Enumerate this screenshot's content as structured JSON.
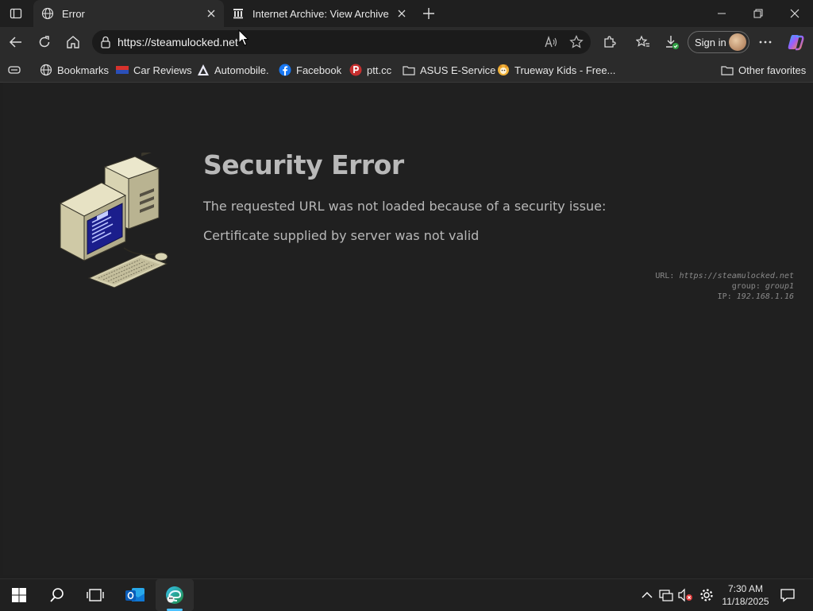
{
  "tabs": [
    {
      "title": "Error",
      "active": true
    },
    {
      "title": "Internet Archive: View Archive",
      "active": false
    }
  ],
  "address": {
    "url": "https://steamulocked.net"
  },
  "profile": {
    "signin_label": "Sign in"
  },
  "bookmarks": [
    {
      "label": "Bookmarks",
      "icon": "globe-icon"
    },
    {
      "label": "Car Reviews",
      "icon": "flag-icon"
    },
    {
      "label": "Automobile.",
      "icon": "triangle-logo-icon"
    },
    {
      "label": "Facebook",
      "icon": "facebook-icon"
    },
    {
      "label": "ptt.cc",
      "icon": "p-logo-icon"
    },
    {
      "label": "ASUS E-Service",
      "icon": "folder-icon"
    },
    {
      "label": "Trueway Kids - Free...",
      "icon": "trueway-icon"
    }
  ],
  "other_favorites": "Other favorites",
  "error": {
    "title": "Security Error",
    "line1": "The requested URL was not loaded because of a security issue:",
    "line2": "Certificate supplied by server was not valid",
    "meta_url_label": "URL:",
    "meta_url": "https://steamulocked.net",
    "meta_group_label": "group:",
    "meta_group": "group1",
    "meta_ip_label": "IP:",
    "meta_ip": "192.168.1.16"
  },
  "clock": {
    "time": "7:30 AM",
    "date": "11/18/2025"
  },
  "colors": {
    "accent": "#4cc2ff",
    "tab_active_bg": "#2b2b2b",
    "content_bg": "#202020"
  }
}
